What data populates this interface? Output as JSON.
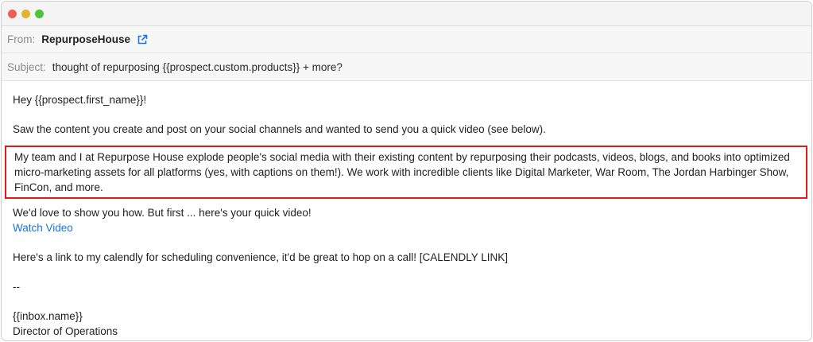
{
  "window": {
    "controls": {
      "close_color": "#ec5f57",
      "minimize_color": "#e1b42e",
      "zoom_color": "#4fc13f"
    }
  },
  "header": {
    "from_label": "From:",
    "from_value": "RepurposeHouse",
    "from_icon": "external-link-icon",
    "subject_label": "Subject:",
    "subject_value": "thought of repurposing {{prospect.custom.products}} + more?"
  },
  "email_body": {
    "greeting": "Hey {{prospect.first_name}}!",
    "intro": "Saw the content you create and post on your social channels and wanted to send you a quick video (see below).",
    "highlight_paragraph": "My team and I at Repurpose House explode people's social media with their existing content by repurposing their podcasts, videos, blogs, and books into optimized micro-marketing assets for all platforms (yes, with captions on them!). We work with incredible clients like Digital Marketer, War Room, The Jordan Harbinger Show, FinCon, and more.",
    "cta_text": "We'd love to show you how. But first ... here's your quick video!",
    "cta_link": "Watch Video",
    "calendly": "Here's a link to my calendly for scheduling convenience, it'd be great to hop on a call! [CALENDLY LINK]",
    "separator": "--",
    "signature_name": "{{inbox.name}}",
    "signature_title": "Director of Operations"
  },
  "colors": {
    "highlight_border": "#e0191b",
    "link": "#1a73e8"
  }
}
